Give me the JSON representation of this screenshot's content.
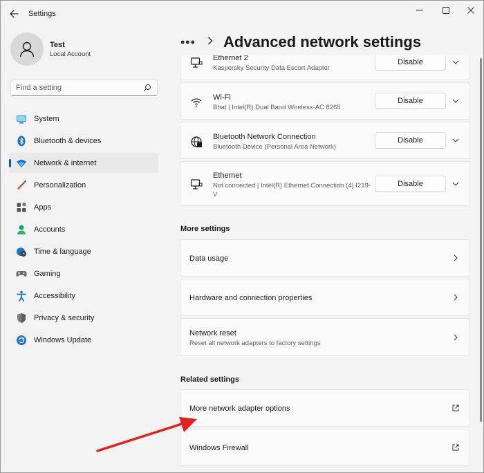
{
  "window": {
    "title": "Settings"
  },
  "profile": {
    "name": "Test",
    "account": "Local Account"
  },
  "search": {
    "placeholder": "Find a setting"
  },
  "nav": [
    {
      "label": "System",
      "icon": "system-icon",
      "active": false
    },
    {
      "label": "Bluetooth & devices",
      "icon": "bluetooth-icon",
      "active": false
    },
    {
      "label": "Network & internet",
      "icon": "wifi-icon",
      "active": true
    },
    {
      "label": "Personalization",
      "icon": "brush-icon",
      "active": false
    },
    {
      "label": "Apps",
      "icon": "apps-icon",
      "active": false
    },
    {
      "label": "Accounts",
      "icon": "accounts-icon",
      "active": false
    },
    {
      "label": "Time & language",
      "icon": "globe-clock-icon",
      "active": false
    },
    {
      "label": "Gaming",
      "icon": "gamepad-icon",
      "active": false
    },
    {
      "label": "Accessibility",
      "icon": "accessibility-icon",
      "active": false
    },
    {
      "label": "Privacy & security",
      "icon": "shield-icon",
      "active": false
    },
    {
      "label": "Windows Update",
      "icon": "update-icon",
      "active": false
    }
  ],
  "header": {
    "more": "•••",
    "title": "Advanced network settings"
  },
  "adapters": [
    {
      "name": "Ethernet 2",
      "detail": "Kaspersky Security Data Escort Adapter",
      "button": "Disable"
    },
    {
      "name": "Wi-Fi",
      "detail": "Bhat | Intel(R) Dual Band Wireless-AC 8265",
      "button": "Disable"
    },
    {
      "name": "Bluetooth Network Connection",
      "detail": "Bluetooth Device (Personal Area Network)",
      "button": "Disable"
    },
    {
      "name": "Ethernet",
      "detail": "Not connected | Intel(R) Ethernet Connection (4) I219-V",
      "button": "Disable"
    }
  ],
  "more_settings": {
    "heading": "More settings",
    "items": [
      {
        "title": "Data usage"
      },
      {
        "title": "Hardware and connection properties"
      },
      {
        "title": "Network reset",
        "subtitle": "Reset all network adapters to factory settings"
      }
    ]
  },
  "related_settings": {
    "heading": "Related settings",
    "items": [
      {
        "title": "More network adapter options"
      },
      {
        "title": "Windows Firewall"
      }
    ]
  },
  "colors": {
    "accent": "#005fb8",
    "annotation_arrow": "#e3201b"
  }
}
